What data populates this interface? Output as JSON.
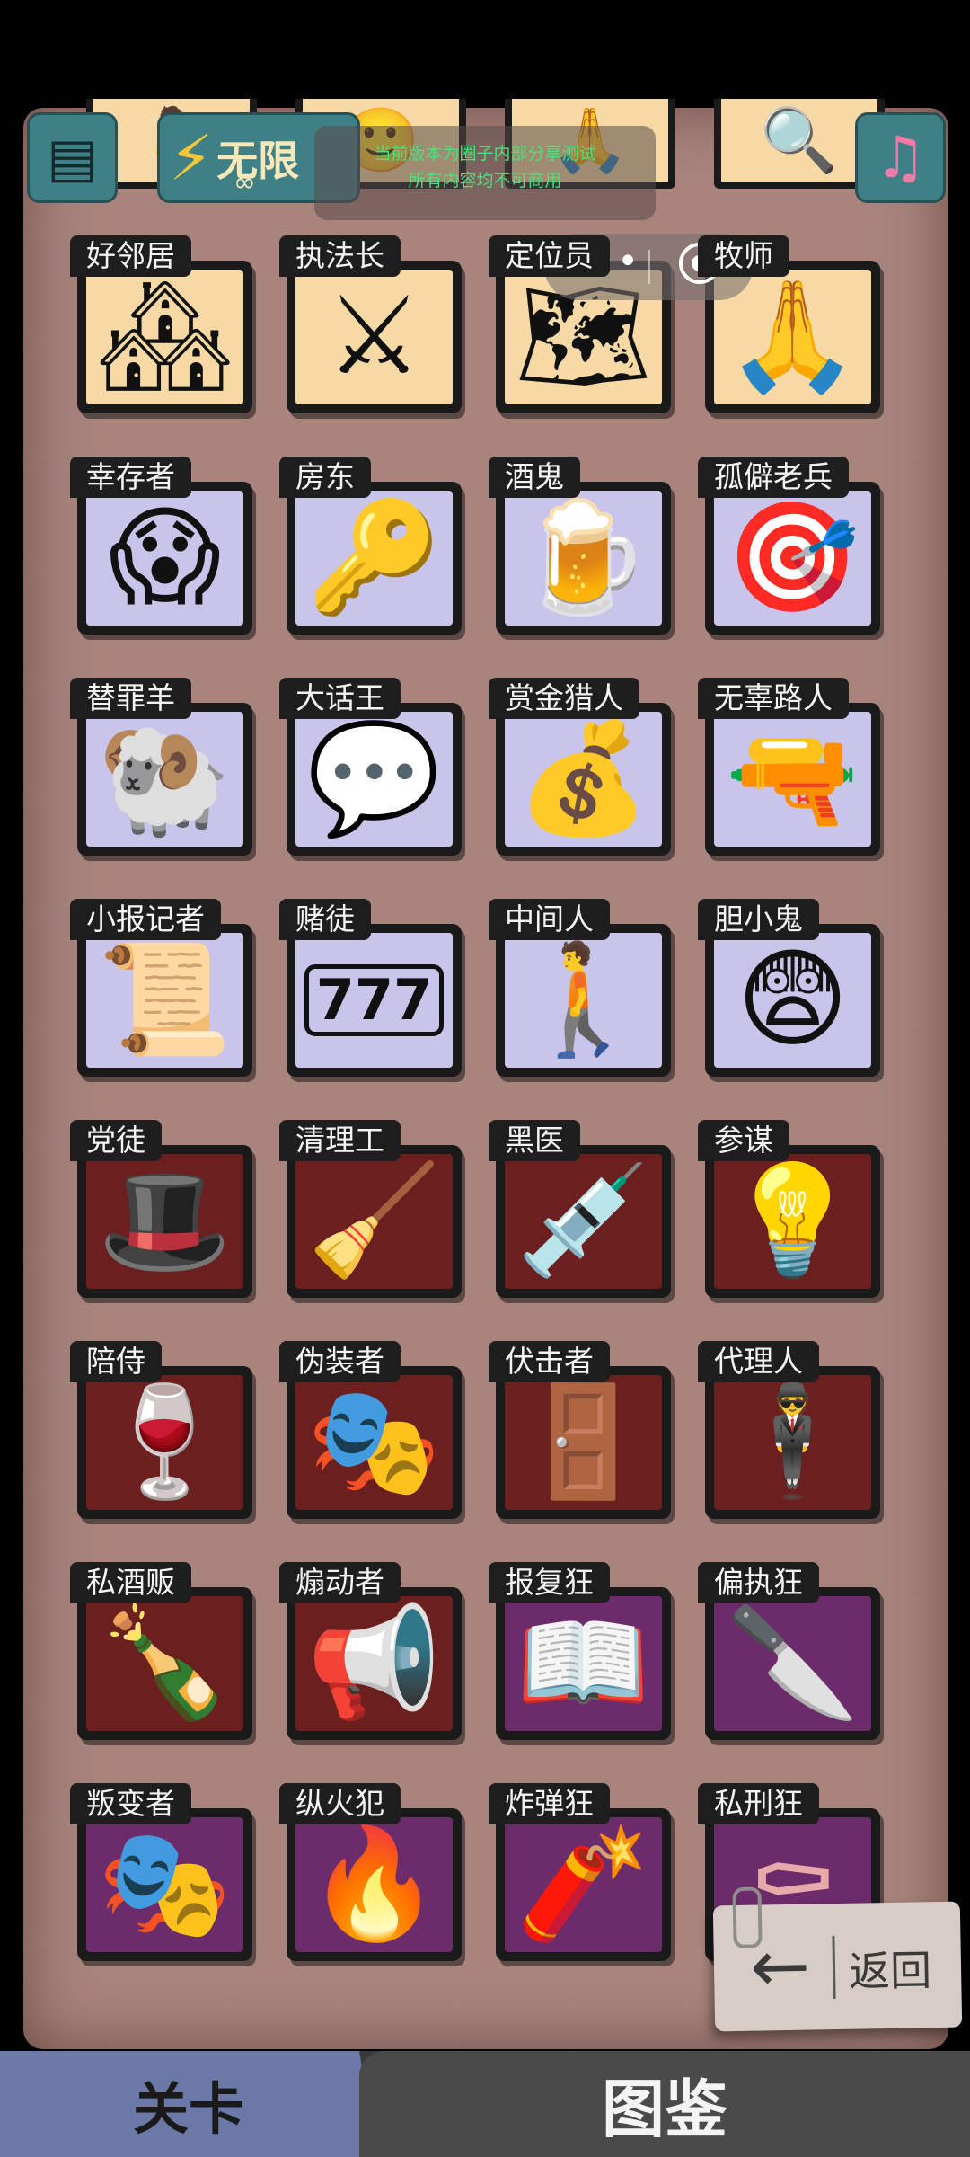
{
  "header": {
    "unlimited_label": "无限",
    "infinity": "∞",
    "notice_line1": "当前版本为圈子内部分享测试",
    "notice_line2": "所有内容均不可商用",
    "capsule_more": "•••"
  },
  "top_row": [
    {
      "pic": "🧍",
      "color": "cream"
    },
    {
      "pic": "🙂",
      "color": "cream"
    },
    {
      "pic": "🙏",
      "color": "cream"
    },
    {
      "pic": "🔍",
      "color": "cream"
    }
  ],
  "cards": [
    {
      "label": "好邻居",
      "pic": "🏘",
      "color": "cream"
    },
    {
      "label": "执法长",
      "pic": "⚔",
      "color": "cream"
    },
    {
      "label": "定位员",
      "pic": "🗺",
      "color": "cream"
    },
    {
      "label": "牧师",
      "pic": "🙏",
      "color": "cream"
    },
    {
      "label": "幸存者",
      "pic": "😱",
      "color": "lav"
    },
    {
      "label": "房东",
      "pic": "🔑",
      "color": "lav"
    },
    {
      "label": "酒鬼",
      "pic": "🍺",
      "color": "lav"
    },
    {
      "label": "孤僻老兵",
      "pic": "🎯",
      "color": "lav"
    },
    {
      "label": "替罪羊",
      "pic": "🐏",
      "color": "lav"
    },
    {
      "label": "大话王",
      "pic": "💬",
      "color": "lav"
    },
    {
      "label": "赏金猎人",
      "pic": "💰",
      "color": "lav"
    },
    {
      "label": "无辜路人",
      "pic": "🔫",
      "color": "lav"
    },
    {
      "label": "小报记者",
      "pic": "📜",
      "color": "lav"
    },
    {
      "label": "赌徒",
      "pic": "777",
      "color": "lav"
    },
    {
      "label": "中间人",
      "pic": "🚶",
      "color": "lav"
    },
    {
      "label": "胆小鬼",
      "pic": "😨",
      "color": "lav"
    },
    {
      "label": "党徒",
      "pic": "🎩",
      "color": "red"
    },
    {
      "label": "清理工",
      "pic": "🧹",
      "color": "red"
    },
    {
      "label": "黑医",
      "pic": "💉",
      "color": "red"
    },
    {
      "label": "参谋",
      "pic": "💡",
      "color": "red"
    },
    {
      "label": "陪侍",
      "pic": "🍷",
      "color": "red"
    },
    {
      "label": "伪装者",
      "pic": "🎭",
      "color": "red"
    },
    {
      "label": "伏击者",
      "pic": "🚪",
      "color": "red"
    },
    {
      "label": "代理人",
      "pic": "🕴",
      "color": "red"
    },
    {
      "label": "私酒贩",
      "pic": "🍾",
      "color": "red"
    },
    {
      "label": "煽动者",
      "pic": "📢",
      "color": "red"
    },
    {
      "label": "报复狂",
      "pic": "📖",
      "color": "purple"
    },
    {
      "label": "偏执狂",
      "pic": "🔪",
      "color": "purple"
    },
    {
      "label": "叛变者",
      "pic": "🎭",
      "color": "purple"
    },
    {
      "label": "纵火犯",
      "pic": "🔥",
      "color": "purple"
    },
    {
      "label": "炸弹狂",
      "pic": "🧨",
      "color": "purple"
    },
    {
      "label": "私刑狂",
      "pic": "⚰",
      "color": "purple"
    }
  ],
  "back_button": {
    "label": "返回",
    "arrow": "←"
  },
  "bottom_tabs": {
    "levels": "关卡",
    "gallery": "图鉴"
  }
}
